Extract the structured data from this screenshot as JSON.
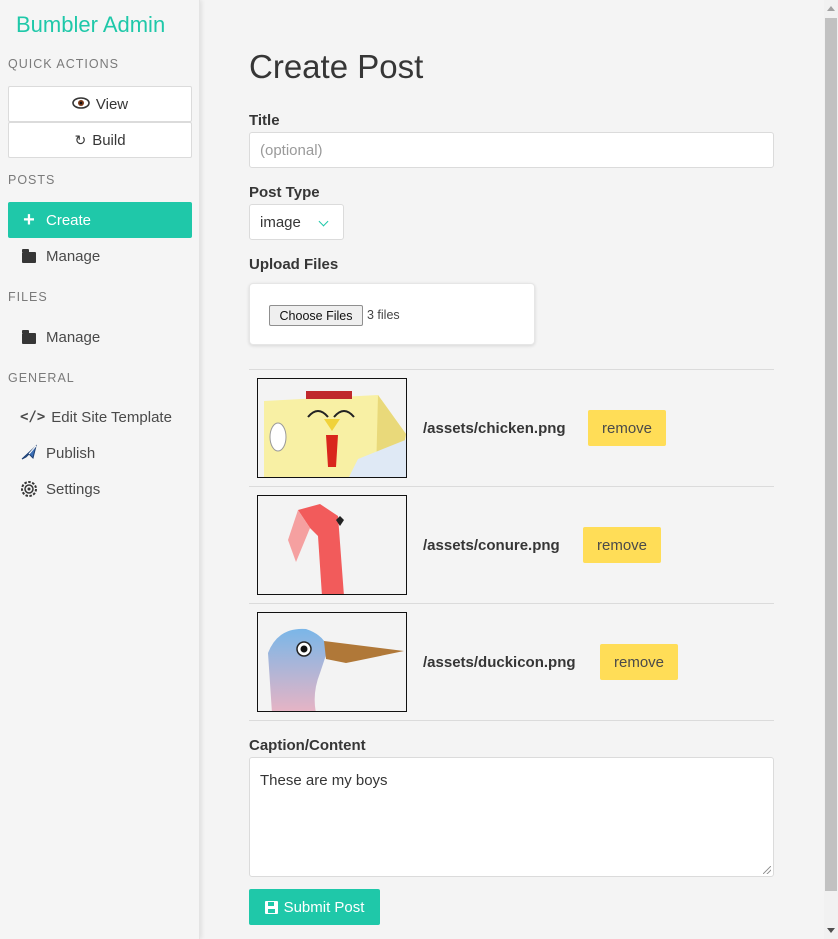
{
  "sidebar": {
    "brand": "Bumbler Admin",
    "sections": {
      "quick_actions": "QUICK ACTIONS",
      "posts": "POSTS",
      "files": "FILES",
      "general": "GENERAL"
    },
    "quick_actions": [
      {
        "label": "View",
        "icon": "eye-icon"
      },
      {
        "label": "Build",
        "icon": "refresh-icon"
      }
    ],
    "posts": [
      {
        "label": "Create",
        "icon": "plus-icon",
        "active": true
      },
      {
        "label": "Manage",
        "icon": "folder-icon"
      }
    ],
    "files": [
      {
        "label": "Manage",
        "icon": "folder-icon"
      }
    ],
    "general": [
      {
        "label": "Edit Site Template",
        "icon": "code-icon",
        "glyph": "</>"
      },
      {
        "label": "Publish",
        "icon": "airplane-icon"
      },
      {
        "label": "Settings",
        "icon": "gear-icon"
      }
    ]
  },
  "main": {
    "heading": "Create Post",
    "title_field": {
      "label": "Title",
      "placeholder": "(optional)",
      "value": ""
    },
    "post_type": {
      "label": "Post Type",
      "value": "image"
    },
    "upload": {
      "label": "Upload Files",
      "button": "Choose Files",
      "status": "3 files"
    },
    "files": [
      {
        "path": "/assets/chicken.png",
        "remove_label": "remove"
      },
      {
        "path": "/assets/conure.png",
        "remove_label": "remove"
      },
      {
        "path": "/assets/duckicon.png",
        "remove_label": "remove"
      }
    ],
    "caption": {
      "label": "Caption/Content",
      "value": "These are my boys"
    },
    "submit": {
      "label": "Submit Post"
    }
  },
  "colors": {
    "accent": "#1fc8a9",
    "warning": "#ffdd57",
    "text": "#363636",
    "sidebar_bg": "#f5f5f5"
  }
}
